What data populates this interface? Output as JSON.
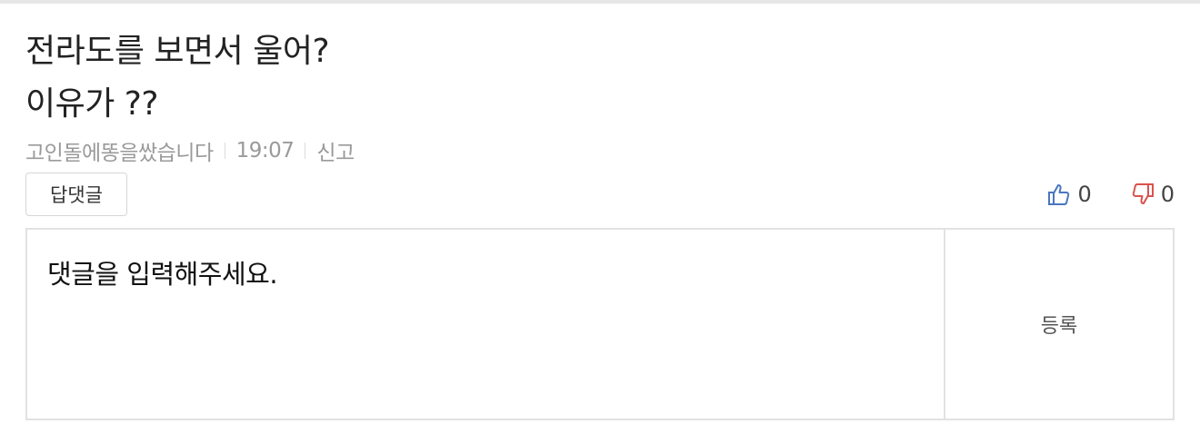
{
  "comment": {
    "text": "전라도를 보면서 울어?\n이유가 ??",
    "author": "고인돌에똥을쌌습니다",
    "time": "19:07",
    "report_label": "신고",
    "reply_label": "답댓글",
    "likes": "0",
    "dislikes": "0"
  },
  "reply_form": {
    "placeholder": "댓글을 입력해주세요.",
    "submit_label": "등록"
  },
  "icons": {
    "like": "thumbs-up-icon",
    "dislike": "thumbs-down-icon"
  },
  "colors": {
    "like": "#4a76c0",
    "dislike": "#d9534f",
    "meta_text": "#9a9a9a",
    "border": "#e2e2e2"
  }
}
